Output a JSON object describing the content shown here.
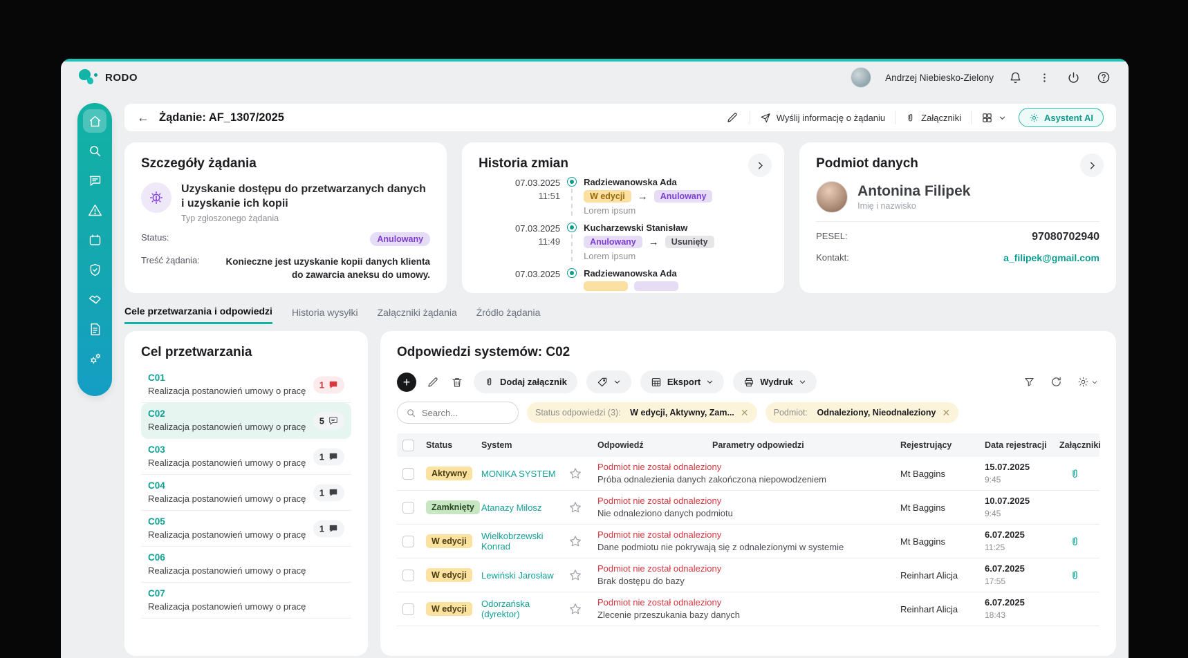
{
  "colors": {
    "accent_teal": "#14b3a6",
    "top_line": "#1fc4b8",
    "alert_red": "#d7373f",
    "status_purple": "#7c3fd1",
    "status_orange": "#fbe0a2",
    "status_green": "#c9e6c2",
    "chip_cream": "#fbf3da",
    "page_bg": "#edeff0"
  },
  "topbar": {
    "app_name": "RODO",
    "user_name": "Andrzej Niebiesko-Zielony"
  },
  "header": {
    "title": "Żądanie: AF_1307/2025",
    "send_label": "Wyślij informację o żądaniu",
    "attachments_label": "Załączniki",
    "ai_label": "Asystent AI"
  },
  "details": {
    "title": "Szczegóły żądania",
    "type_title": "Uzyskanie dostępu do przetwarzanych danych i uzyskanie ich kopii",
    "type_caption": "Typ zgłoszonego żądania",
    "status_label": "Status:",
    "status_value": "Anulowany",
    "content_label": "Treść żądania:",
    "content_value": "Konieczne jest uzyskanie kopii danych klienta do zawarcia aneksu do umowy."
  },
  "history": {
    "title": "Historia zmian",
    "entries": [
      {
        "date": "07.03.2025",
        "time": "11:51",
        "name": "Radziewanowska Ada",
        "from": "W edycji",
        "to": "Anulowany",
        "note": "Lorem ipsum"
      },
      {
        "date": "07.03.2025",
        "time": "11:49",
        "name": "Kucharzewski Stanisław",
        "from": "Anulowany",
        "to": "Usunięty",
        "note": "Lorem ipsum"
      },
      {
        "date": "07.03.2025",
        "time": "",
        "name": "Radziewanowska Ada",
        "from": "",
        "to": "",
        "note": ""
      }
    ]
  },
  "subject": {
    "title": "Podmiot danych",
    "name": "Antonina Filipek",
    "name_caption": "Imię i nazwisko",
    "pesel_label": "PESEL:",
    "pesel_value": "97080702940",
    "contact_label": "Kontakt:",
    "contact_value": "a_filipek@gmail.com"
  },
  "tabs": {
    "items": [
      {
        "label": "Cele przetwarzania i odpowiedzi"
      },
      {
        "label": "Historia wysyłki"
      },
      {
        "label": "Załączniki żądania"
      },
      {
        "label": "Źródło żądania"
      }
    ]
  },
  "purposes": {
    "title": "Cel przetwarzania",
    "items": [
      {
        "code": "C01",
        "desc": "Realizacja postanowień umowy o pracę",
        "count": "1"
      },
      {
        "code": "C02",
        "desc": "Realizacja postanowień umowy o pracę",
        "count": "5"
      },
      {
        "code": "C03",
        "desc": "Realizacja postanowień umowy o pracę",
        "count": "1"
      },
      {
        "code": "C04",
        "desc": "Realizacja postanowień umowy o pracę",
        "count": "1"
      },
      {
        "code": "C05",
        "desc": "Realizacja postanowień umowy o pracę",
        "count": "1"
      },
      {
        "code": "C06",
        "desc": "Realizacja postanowień umowy o pracę",
        "count": ""
      },
      {
        "code": "C07",
        "desc": "Realizacja postanowień umowy o pracę",
        "count": ""
      }
    ]
  },
  "responses": {
    "title": "Odpowiedzi systemów: C02",
    "toolbar": {
      "add_attachment": "Dodaj załącznik",
      "export": "Eksport",
      "print": "Wydruk"
    },
    "search_placeholder": "Search...",
    "filters": [
      {
        "label": "Status odpowiedzi (3):",
        "value": "W edycji, Aktywny, Zam..."
      },
      {
        "label": "Podmiot:",
        "value": "Odnaleziony, Nieodnaleziony"
      }
    ],
    "columns": {
      "status": "Status",
      "system": "System",
      "response": "Odpowiedź",
      "params": "Parametry odpowiedzi",
      "registrant": "Rejestrujący",
      "date": "Data rejestracji",
      "attachments": "Załączniki"
    },
    "rows": [
      {
        "status": "Aktywny",
        "system": "MONIKA SYSTEM",
        "resp_title": "Podmiot nie został odnaleziony",
        "resp_sub": "Próba odnalezienia danych zakończona niepowodzeniem",
        "registrant": "Mt Baggins",
        "date": "15.07.2025",
        "time": "9:45"
      },
      {
        "status": "Zamknięty",
        "system": "Atanazy Milosz",
        "resp_title": "Podmiot nie został odnaleziony",
        "resp_sub": "Nie odnaleziono danych podmiotu",
        "registrant": "Mt Baggins",
        "date": "10.07.2025",
        "time": "9:45"
      },
      {
        "status": "W edycji",
        "system": "Wielkobrzewski Konrad",
        "resp_title": "Podmiot nie został odnaleziony",
        "resp_sub": "Dane podmiotu nie pokrywają się z odnalezionymi w systemie",
        "registrant": "Mt Baggins",
        "date": "6.07.2025",
        "time": "11:25"
      },
      {
        "status": "W edycji",
        "system": "Lewiński Jarosław",
        "resp_title": "Podmiot nie został odnaleziony",
        "resp_sub": "Brak dostępu do bazy",
        "registrant": "Reinhart Alicja",
        "date": "6.07.2025",
        "time": "17:55"
      },
      {
        "status": "W edycji",
        "system": "Odorzańska (dyrektor)",
        "resp_title": "Podmiot nie został odnaleziony",
        "resp_sub": "Zlecenie przeszukania bazy danych",
        "registrant": "Reinhart Alicja",
        "date": "6.07.2025",
        "time": "18:43"
      }
    ]
  }
}
